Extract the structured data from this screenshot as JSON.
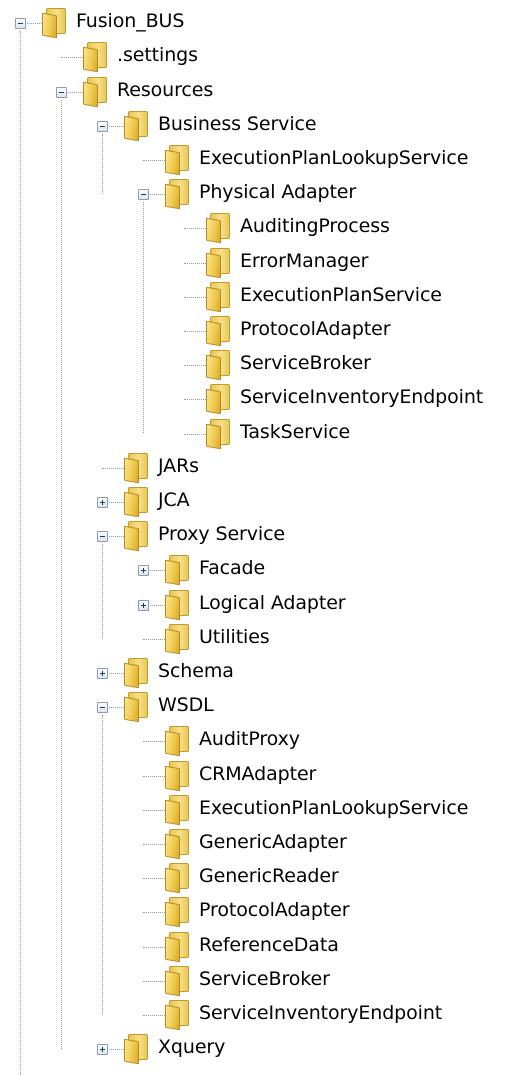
{
  "tree": {
    "label": "Fusion_BUS",
    "expanded": true,
    "icon": "folder-icon",
    "children": [
      {
        "label": ".settings",
        "icon": "folder-icon"
      },
      {
        "label": "Resources",
        "icon": "folder-icon",
        "expanded": true,
        "children": [
          {
            "label": "Business Service",
            "icon": "folder-icon",
            "expanded": true,
            "children": [
              {
                "label": "ExecutionPlanLookupService",
                "icon": "folder-icon"
              },
              {
                "label": "Physical Adapter",
                "icon": "folder-icon",
                "expanded": true,
                "children": [
                  {
                    "label": "AuditingProcess",
                    "icon": "folder-icon"
                  },
                  {
                    "label": "ErrorManager",
                    "icon": "folder-icon"
                  },
                  {
                    "label": "ExecutionPlanService",
                    "icon": "folder-icon"
                  },
                  {
                    "label": "ProtocolAdapter",
                    "icon": "folder-icon"
                  },
                  {
                    "label": "ServiceBroker",
                    "icon": "folder-icon"
                  },
                  {
                    "label": "ServiceInventoryEndpoint",
                    "icon": "folder-icon"
                  },
                  {
                    "label": "TaskService",
                    "icon": "folder-icon"
                  }
                ]
              }
            ]
          },
          {
            "label": "JARs",
            "icon": "folder-icon"
          },
          {
            "label": "JCA",
            "icon": "folder-icon",
            "expanded": false,
            "children": []
          },
          {
            "label": "Proxy Service",
            "icon": "folder-icon",
            "expanded": true,
            "children": [
              {
                "label": "Facade",
                "icon": "folder-icon",
                "expanded": false,
                "children": []
              },
              {
                "label": "Logical Adapter",
                "icon": "folder-icon",
                "expanded": false,
                "children": []
              },
              {
                "label": "Utilities",
                "icon": "folder-icon"
              }
            ]
          },
          {
            "label": "Schema",
            "icon": "folder-icon",
            "expanded": false,
            "children": []
          },
          {
            "label": "WSDL",
            "icon": "folder-icon",
            "expanded": true,
            "children": [
              {
                "label": "AuditProxy",
                "icon": "folder-icon"
              },
              {
                "label": "CRMAdapter",
                "icon": "folder-icon"
              },
              {
                "label": "ExecutionPlanLookupService",
                "icon": "folder-icon"
              },
              {
                "label": "GenericAdapter",
                "icon": "folder-icon"
              },
              {
                "label": "GenericReader",
                "icon": "folder-icon"
              },
              {
                "label": "ProtocolAdapter",
                "icon": "folder-icon"
              },
              {
                "label": "ReferenceData",
                "icon": "folder-icon"
              },
              {
                "label": "ServiceBroker",
                "icon": "folder-icon"
              },
              {
                "label": "ServiceInventoryEndpoint",
                "icon": "folder-icon"
              }
            ]
          },
          {
            "label": "Xquery",
            "icon": "folder-icon",
            "expanded": false,
            "children": []
          }
        ]
      }
    ]
  }
}
